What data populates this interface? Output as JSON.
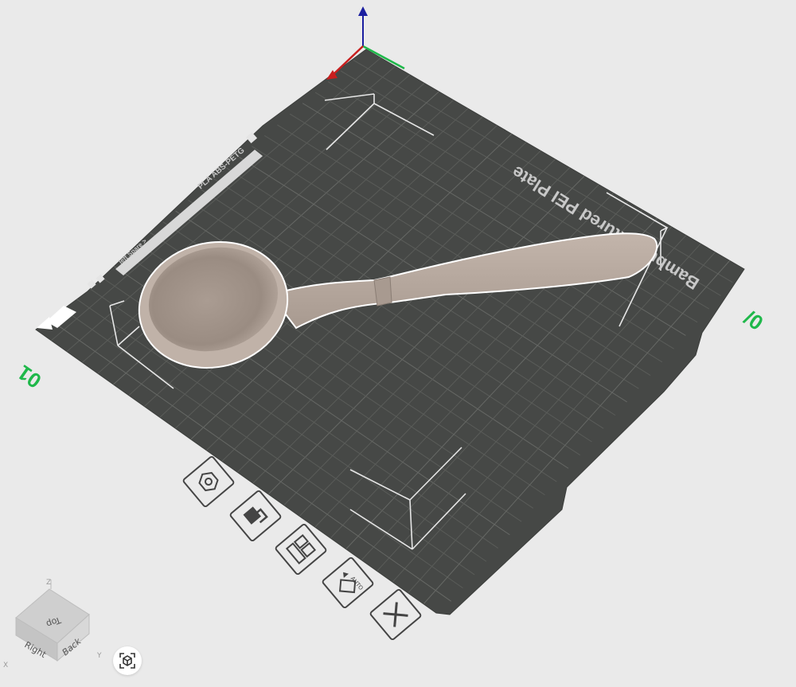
{
  "plate": {
    "name": "Bambu Textured PEI Plate",
    "label_strip": "PLA ABS-PETG",
    "left_index": "01",
    "right_index": "0/",
    "small_label": "left  Spare  >"
  },
  "model": {
    "name": "spoon",
    "color": "#b8aaa0"
  },
  "plate_tools": [
    {
      "id": "orient",
      "icon": "hexagon-orient-icon"
    },
    {
      "id": "lock",
      "icon": "plate-lock-icon"
    },
    {
      "id": "arrange",
      "icon": "arrange-icon"
    },
    {
      "id": "auto-orient",
      "icon": "auto-orient-icon",
      "badge": "AUTO"
    },
    {
      "id": "close",
      "icon": "close-x-icon"
    }
  ],
  "view_cube": {
    "top": "Top",
    "right": "Right",
    "back": "Back",
    "axis_x": "X",
    "axis_y": "Y",
    "axis_z": "Z"
  },
  "colors": {
    "plate": "#464846",
    "grid": "#5c5e5b",
    "background": "#eaeaea",
    "accent": "#1fb84a",
    "axis_z": "#1b1fa0",
    "axis_x": "#c81e1e"
  }
}
